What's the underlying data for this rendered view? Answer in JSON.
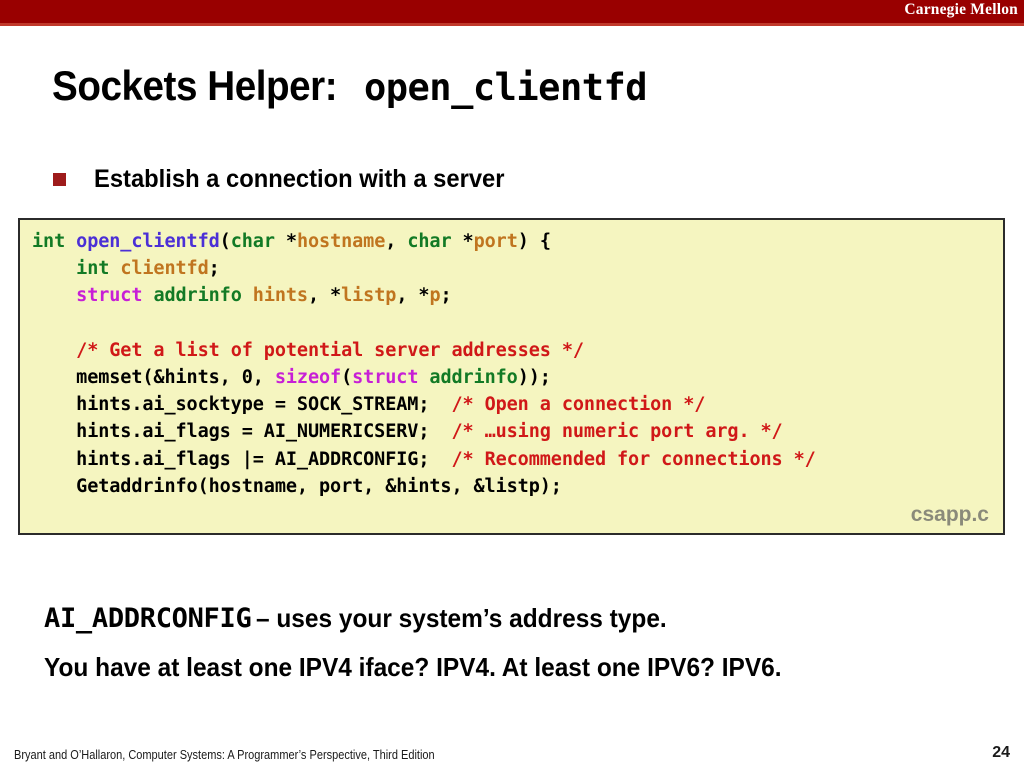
{
  "banner": {
    "institution": "Carnegie Mellon",
    "bg_color": "#990000",
    "strip_color": "#c0392b"
  },
  "title": {
    "prefix": "Sockets Helper:",
    "code_name": "open_clientfd"
  },
  "bullet": {
    "marker": "square-bullet",
    "marker_color": "#9e1b1b",
    "text": "Establish a connection with a server"
  },
  "code": {
    "filename": "csapp.c",
    "background": "#f5f5c0",
    "border_color": "#2b2b2b",
    "colors": {
      "keyword": "#127a25",
      "function": "#4b2fd6",
      "identifier": "#c0751f",
      "magenta": "#c71fd6",
      "comment": "#d01818",
      "plain": "#000000"
    },
    "lines": [
      [
        {
          "t": "int ",
          "c": "k-green"
        },
        {
          "t": "open_clientfd",
          "c": "k-func"
        },
        {
          "t": "(",
          "c": "k-plain"
        },
        {
          "t": "char ",
          "c": "k-green"
        },
        {
          "t": "*",
          "c": "k-plain"
        },
        {
          "t": "hostname",
          "c": "k-ident"
        },
        {
          "t": ", ",
          "c": "k-plain"
        },
        {
          "t": "char ",
          "c": "k-green"
        },
        {
          "t": "*",
          "c": "k-plain"
        },
        {
          "t": "port",
          "c": "k-ident"
        },
        {
          "t": ") {",
          "c": "k-plain"
        }
      ],
      [
        {
          "t": "    ",
          "c": "k-plain"
        },
        {
          "t": "int ",
          "c": "k-green"
        },
        {
          "t": "clientfd",
          "c": "k-ident"
        },
        {
          "t": ";",
          "c": "k-plain"
        }
      ],
      [
        {
          "t": "    ",
          "c": "k-plain"
        },
        {
          "t": "struct ",
          "c": "k-magenta"
        },
        {
          "t": "addrinfo ",
          "c": "k-green"
        },
        {
          "t": "hints",
          "c": "k-ident"
        },
        {
          "t": ", *",
          "c": "k-plain"
        },
        {
          "t": "listp",
          "c": "k-ident"
        },
        {
          "t": ", *",
          "c": "k-plain"
        },
        {
          "t": "p",
          "c": "k-ident"
        },
        {
          "t": ";",
          "c": "k-plain"
        }
      ],
      [],
      [
        {
          "t": "    ",
          "c": "k-plain"
        },
        {
          "t": "/* Get a list of potential server addresses */",
          "c": "k-comment"
        }
      ],
      [
        {
          "t": "    memset(&hints, 0, ",
          "c": "k-plain"
        },
        {
          "t": "sizeof",
          "c": "k-magenta"
        },
        {
          "t": "(",
          "c": "k-plain"
        },
        {
          "t": "struct ",
          "c": "k-magenta"
        },
        {
          "t": "addrinfo",
          "c": "k-green"
        },
        {
          "t": "));",
          "c": "k-plain"
        }
      ],
      [
        {
          "t": "    hints.ai_socktype = SOCK_STREAM;",
          "c": "k-plain"
        },
        {
          "t": "  /* Open a connection */",
          "c": "k-comment"
        }
      ],
      [
        {
          "t": "    hints.ai_flags = AI_NUMERICSERV;",
          "c": "k-plain"
        },
        {
          "t": "  /* …using numeric port arg. */",
          "c": "k-comment"
        }
      ],
      [
        {
          "t": "    hints.ai_flags |= AI_ADDRCONFIG;",
          "c": "k-plain"
        },
        {
          "t": "  /* Recommended for connections */",
          "c": "k-comment"
        }
      ],
      [
        {
          "t": "    Getaddrinfo(hostname, port, &hints, &listp);",
          "c": "k-plain"
        }
      ]
    ]
  },
  "note": {
    "line1_mono": "AI_ADDRCONFIG",
    "line1_sans": "–  uses your system’s address type.",
    "line2": "You have at least one IPV4 iface? IPV4.  At least one IPV6? IPV6."
  },
  "footer": {
    "citation": "Bryant and O’Hallaron, Computer Systems: A Programmer’s Perspective, Third Edition",
    "page_number": "24"
  }
}
